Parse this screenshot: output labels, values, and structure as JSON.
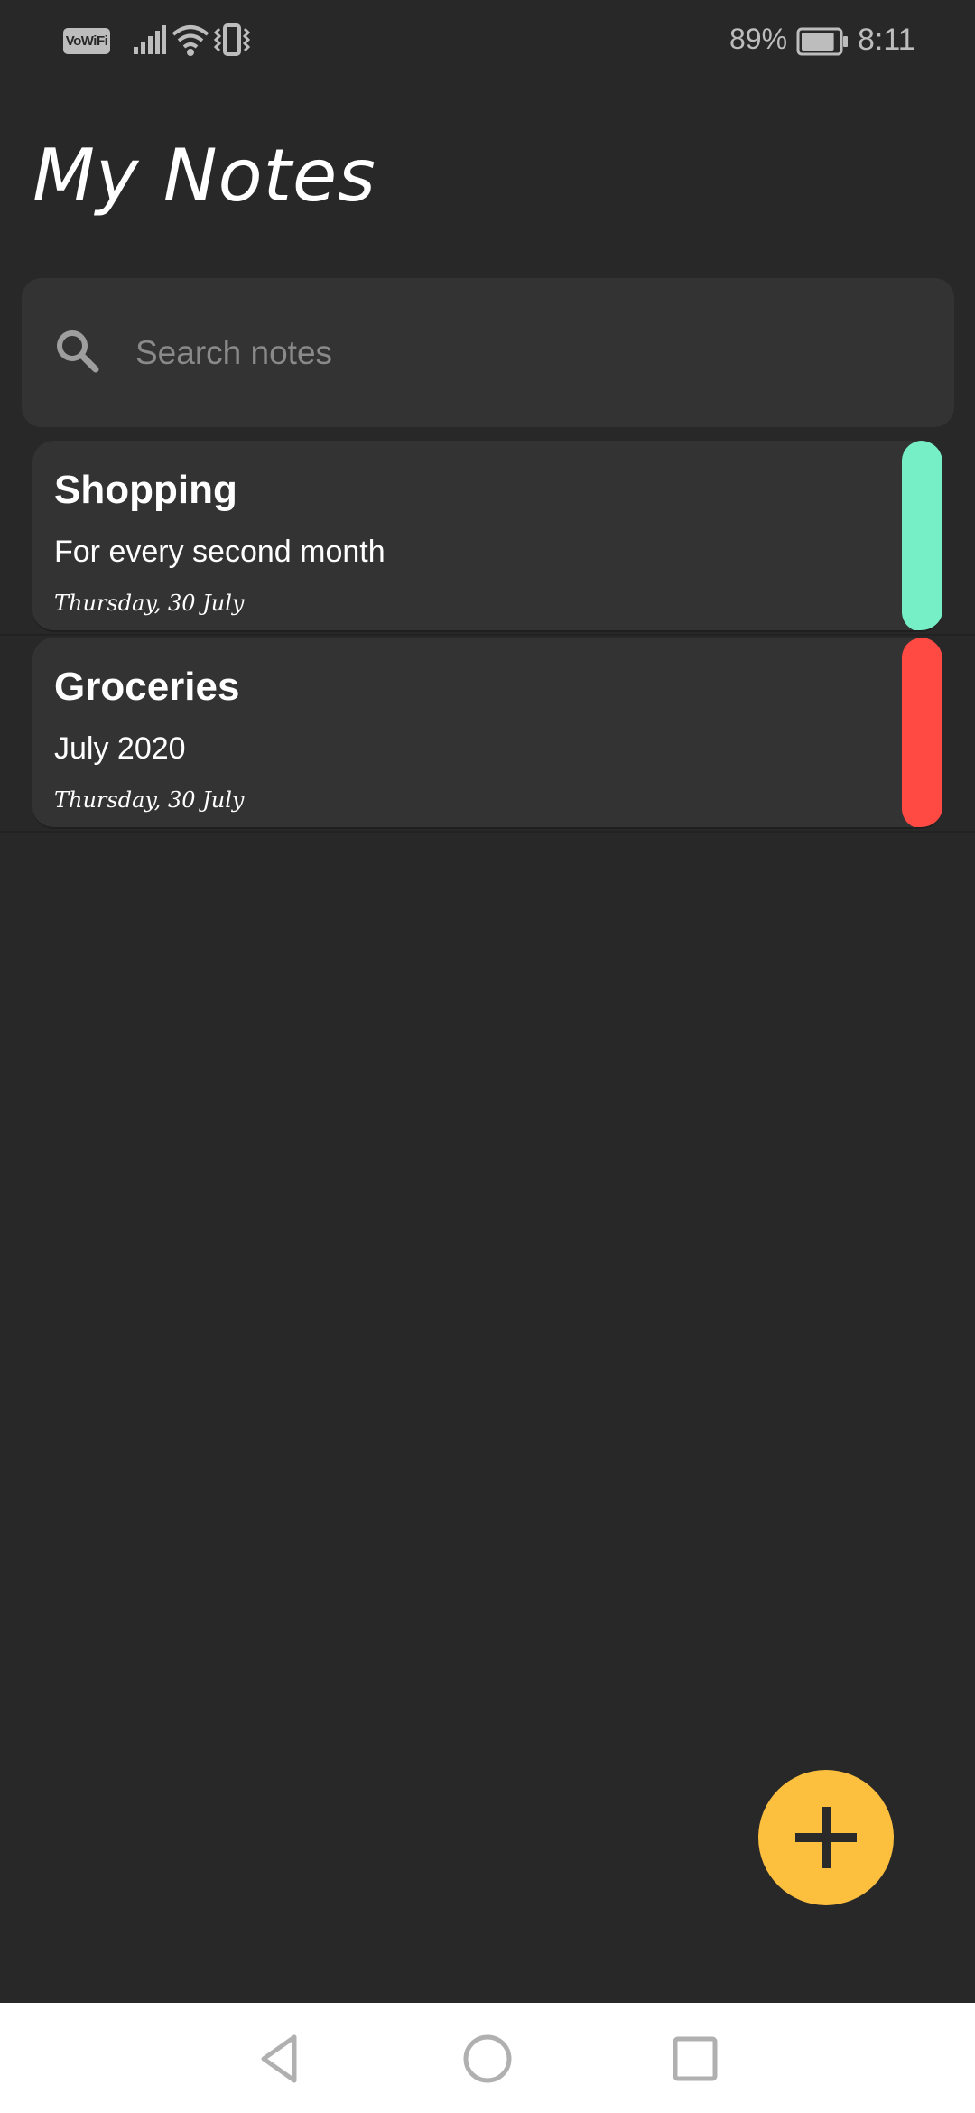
{
  "status_bar": {
    "vowifi": "VoWiFi",
    "battery_percent": "89%",
    "battery_level": 0.89,
    "time": "8:11"
  },
  "header": {
    "title": "My Notes"
  },
  "search": {
    "placeholder": "Search notes",
    "value": ""
  },
  "notes": [
    {
      "title": "Shopping",
      "subtitle": "For every second month",
      "date": "Thursday, 30 July",
      "color": "#76EEC6"
    },
    {
      "title": "Groceries",
      "subtitle": "July 2020",
      "date": "Thursday, 30 July",
      "color": "#FF4A44"
    }
  ],
  "fab": {
    "icon": "plus-icon",
    "color": "#FDBF3E"
  },
  "nav": {
    "back_icon": "back-triangle-icon",
    "home_icon": "home-circle-icon",
    "recents_icon": "recents-square-icon"
  }
}
